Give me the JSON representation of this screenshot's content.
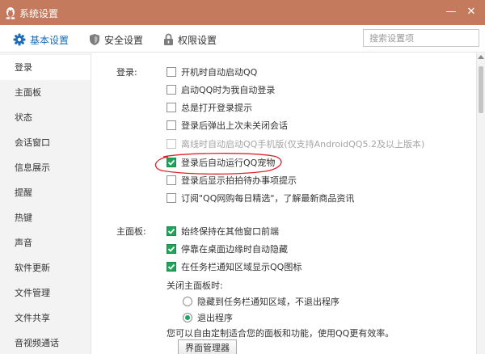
{
  "window": {
    "title": "系统设置",
    "titlebar_color": "#c47a5d",
    "controls": {
      "minimize": "—",
      "close": "✕"
    }
  },
  "tabs": [
    {
      "label": "基本设置",
      "icon": "gear-icon",
      "active": true
    },
    {
      "label": "安全设置",
      "icon": "shield-icon",
      "active": false
    },
    {
      "label": "权限设置",
      "icon": "lock-icon",
      "active": false
    }
  ],
  "search": {
    "placeholder": "搜索设置项",
    "value": ""
  },
  "sidebar": {
    "items": [
      {
        "label": "登录",
        "active": true
      },
      {
        "label": "主面板"
      },
      {
        "label": "状态"
      },
      {
        "label": "会话窗口"
      },
      {
        "label": "信息展示"
      },
      {
        "label": "提醒"
      },
      {
        "label": "热键"
      },
      {
        "label": "声音"
      },
      {
        "label": "软件更新"
      },
      {
        "label": "文件管理"
      },
      {
        "label": "文件共享"
      },
      {
        "label": "音视频通话"
      }
    ]
  },
  "login_section": {
    "label": "登录:",
    "options": [
      {
        "label": "开机时自动启动QQ",
        "checked": false
      },
      {
        "label": "启动QQ时为我自动登录",
        "checked": false
      },
      {
        "label": "总是打开登录提示",
        "checked": false
      },
      {
        "label": "登录后弹出上次未关闭会话",
        "checked": false
      },
      {
        "label": "离线时自动启动QQ手机版(仅支持AndroidQQ5.2及以上版本)",
        "checked": false,
        "disabled": true
      },
      {
        "label": "登录后自动运行QQ宠物",
        "checked": true,
        "highlighted": true
      },
      {
        "label": "登录后显示拍拍待办事项提示",
        "checked": false
      },
      {
        "label": "订阅\"QQ网购每日精选\"，了解最新商品资讯",
        "checked": false
      }
    ]
  },
  "panel_section": {
    "label": "主面板:",
    "options": [
      {
        "label": "始终保持在其他窗口前端",
        "checked": true
      },
      {
        "label": "停靠在桌面边缘时自动隐藏",
        "checked": true
      },
      {
        "label": "在任务栏通知区域显示QQ图标",
        "checked": true
      }
    ],
    "close_label": "关闭主面板时:",
    "close_options": [
      {
        "label": "隐藏到任务栏通知区域，不退出程序",
        "selected": false
      },
      {
        "label": "退出程序",
        "selected": true
      }
    ],
    "note": "您可以自由定制适合您的面板和功能，使用QQ更有效率。",
    "manager_button": "界面管理器"
  },
  "colors": {
    "accent": "#1c6bb5",
    "check_green": "#20a35a",
    "annotation_red": "#d9252a"
  }
}
